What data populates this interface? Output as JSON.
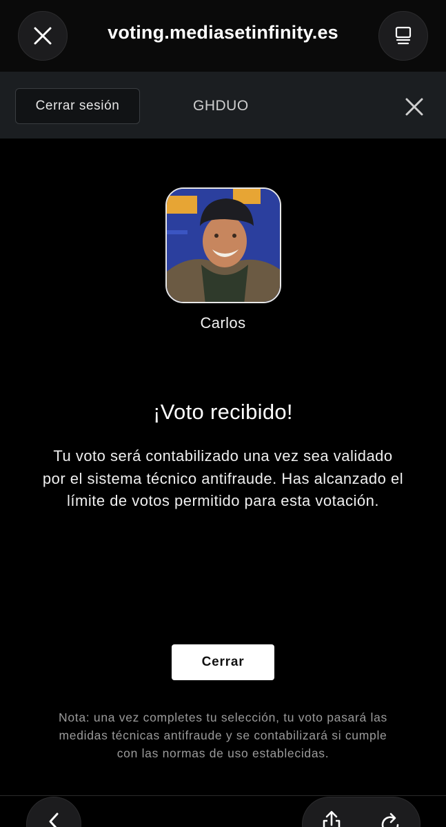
{
  "browser": {
    "url": "voting.mediasetinfinity.es",
    "icons": [
      "close-icon",
      "tab-overview-icon",
      "back-icon",
      "share-icon",
      "reload-icon"
    ]
  },
  "header": {
    "logout_label": "Cerrar sesión",
    "code": "GHDUO",
    "icons": [
      "close-icon"
    ]
  },
  "candidate": {
    "name": "Carlos"
  },
  "confirmation": {
    "title": "¡Voto recibido!",
    "message": "Tu voto será contabilizado una vez sea validado por el sistema técnico antifraude. Has alcanzado el límite de votos permitido para esta votación.",
    "close_label": "Cerrar",
    "note": "Nota: una vez completes tu selección, tu voto pasará las medidas técnicas antifraude y se contabilizará si cumple con las normas de uso establecidas."
  },
  "colors": {
    "background": "#000000",
    "header_bg": "#1b1e21",
    "button_bg": "#ffffff",
    "note_text": "#9b9b9b"
  }
}
